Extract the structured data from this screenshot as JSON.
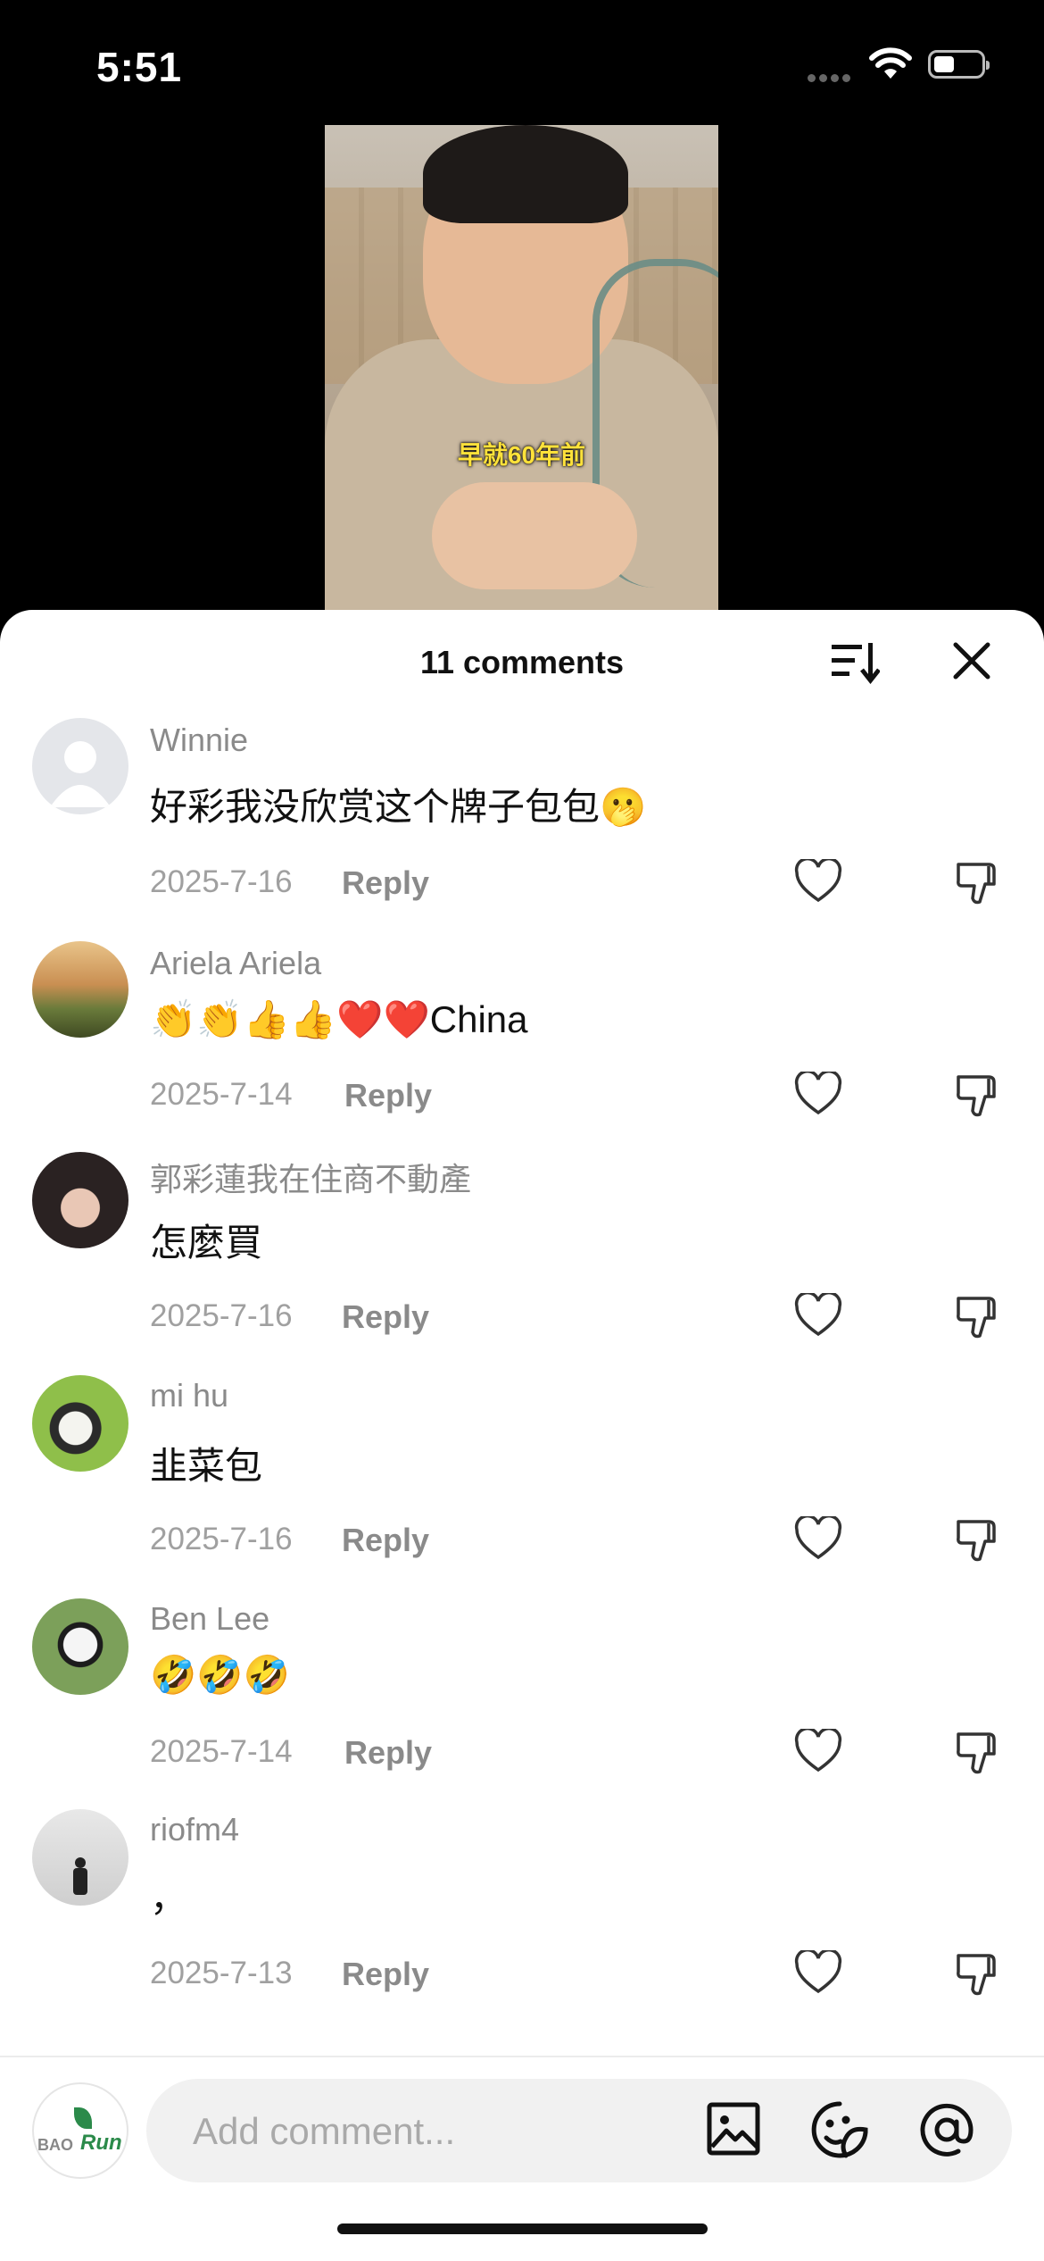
{
  "status_bar": {
    "time": "5:51"
  },
  "video": {
    "caption": "早就60年前"
  },
  "sheet": {
    "count_label": "11 comments",
    "icons": {
      "sort": "sort-icon",
      "close": "close-icon"
    }
  },
  "comments": [
    {
      "username": "Winnie",
      "text": "好彩我没欣赏这个牌子包包🫢",
      "date": "2025-7-16",
      "reply": "Reply",
      "avatar": "default-avatar"
    },
    {
      "username": "Ariela Ariela",
      "text": "👏👏👍👍❤️❤️China",
      "date": "2025-7-14",
      "reply": "Reply",
      "avatar": "tulip-field-avatar"
    },
    {
      "username": "郭彩蓮我在住商不動產",
      "text": "怎麼買",
      "date": "2025-7-16",
      "reply": "Reply",
      "avatar": "woman-portrait-avatar"
    },
    {
      "username": "mi hu",
      "text": "韭菜包",
      "date": "2025-7-16",
      "reply": "Reply",
      "avatar": "cat-avatar"
    },
    {
      "username": "Ben Lee",
      "text": "🤣🤣🤣",
      "date": "2025-7-14",
      "reply": "Reply",
      "avatar": "panda-avatar"
    },
    {
      "username": "riofm4",
      "text": "，",
      "date": "2025-7-13",
      "reply": "Reply",
      "avatar": "silhouette-avatar"
    }
  ],
  "composer": {
    "placeholder": "Add comment...",
    "avatar_text": {
      "left": "BAO",
      "right": "Run"
    }
  },
  "colors": {
    "sheet_bg": "#ffffff",
    "input_bg": "#f1f1f1",
    "muted_text": "#8a8a8a"
  }
}
